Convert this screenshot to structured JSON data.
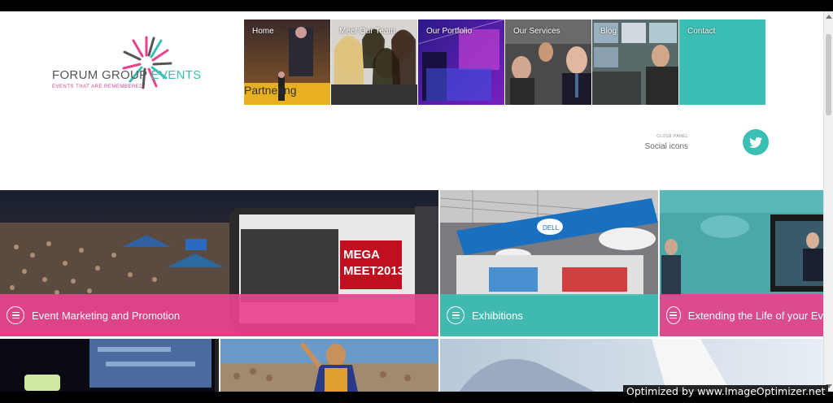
{
  "logo": {
    "name_main": "FORUM GROUP ",
    "name_accent": "EVENTS",
    "tagline": "EVENTS THAT ARE REMEMBERED"
  },
  "nav": {
    "items": [
      {
        "label": "Home"
      },
      {
        "label": "Meet Our Team"
      },
      {
        "label": "Our Portfolio"
      },
      {
        "label": "Our Services"
      },
      {
        "label": "Blog"
      },
      {
        "label": "Contact"
      }
    ]
  },
  "social": {
    "close_panel": "CLOSE PANEL",
    "label": "Social icons",
    "icon": "twitter-icon"
  },
  "tiles": [
    {
      "title": "Event Marketing and Promotion",
      "color": "pink",
      "icon": "list-icon"
    },
    {
      "title": "Exhibitions",
      "color": "teal",
      "icon": "list-icon"
    },
    {
      "title": "Extending the Life of your Ev",
      "color": "pink",
      "icon": "list-icon"
    }
  ],
  "photo_text": {
    "mega_meet": "MEGA MEET 2013",
    "partner": "Partnering",
    "dell": "DELL"
  },
  "colors": {
    "pink": "#e8428d",
    "teal": "#3bbfb5"
  },
  "watermark": "Optimized by www.ImageOptimizer.net"
}
